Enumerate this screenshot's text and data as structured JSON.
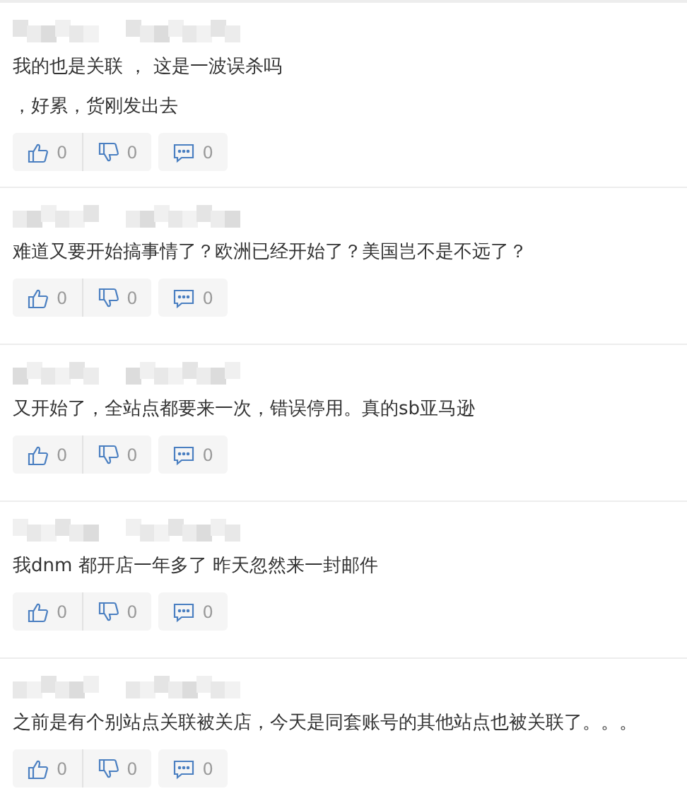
{
  "comments": [
    {
      "lines": [
        "我的也是关联 ， 这是一波误杀吗",
        "，好累，货刚发出去"
      ],
      "likes": "0",
      "dislikes": "0",
      "replies": "0"
    },
    {
      "lines": [
        "难道又要开始搞事情了？欧洲已经开始了？美国岂不是不远了？"
      ],
      "likes": "0",
      "dislikes": "0",
      "replies": "0"
    },
    {
      "lines": [
        "又开始了，全站点都要来一次，错误停用。真的sb亚马逊"
      ],
      "likes": "0",
      "dislikes": "0",
      "replies": "0"
    },
    {
      "lines": [
        "我dnm 都开店一年多了 昨天忽然来一封邮件"
      ],
      "likes": "0",
      "dislikes": "0",
      "replies": "0"
    },
    {
      "lines": [
        "之前是有个别站点关联被关店，今天是同套账号的其他站点也被关联了。。。"
      ],
      "likes": "0",
      "dislikes": "0",
      "replies": "0"
    }
  ]
}
